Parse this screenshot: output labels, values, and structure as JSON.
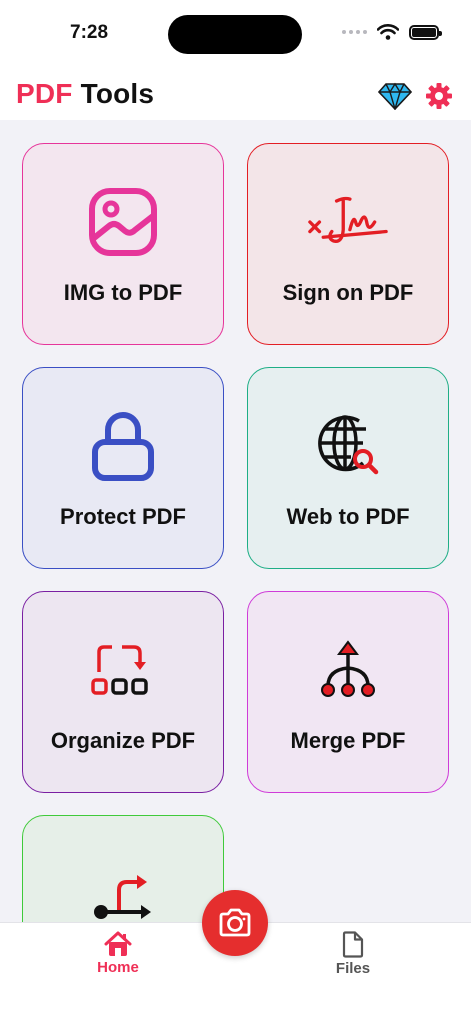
{
  "status_bar": {
    "time": "7:28"
  },
  "header": {
    "title_part1": "PDF",
    "title_part2": "Tools",
    "premium_icon": "diamond-icon",
    "settings_icon": "gear-icon"
  },
  "colors": {
    "accent": "#ef2f56",
    "camera": "#e52e2e"
  },
  "tools": [
    {
      "label": "IMG to PDF",
      "icon": "image-icon",
      "border": "#e6359a",
      "bg": "#f3e6ef"
    },
    {
      "label": "Sign on PDF",
      "icon": "signature-icon",
      "border": "#e31e24",
      "bg": "#f3e5e8"
    },
    {
      "label": "Protect PDF",
      "icon": "lock-icon",
      "border": "#3a4fc4",
      "bg": "#e8e9f4"
    },
    {
      "label": "Web to PDF",
      "icon": "globe-search-icon",
      "border": "#1fae86",
      "bg": "#e6eff0"
    },
    {
      "label": "Organize PDF",
      "icon": "organize-icon",
      "border": "#7a1fa2",
      "bg": "#ede6f1"
    },
    {
      "label": "Merge PDF",
      "icon": "merge-icon",
      "border": "#cf3bd8",
      "bg": "#f1e6f3"
    },
    {
      "label": "",
      "icon": "split-icon",
      "border": "#3fca3a",
      "bg": "#e6efe8"
    }
  ],
  "tab_bar": {
    "home_label": "Home",
    "files_label": "Files",
    "camera_icon": "camera-icon"
  }
}
